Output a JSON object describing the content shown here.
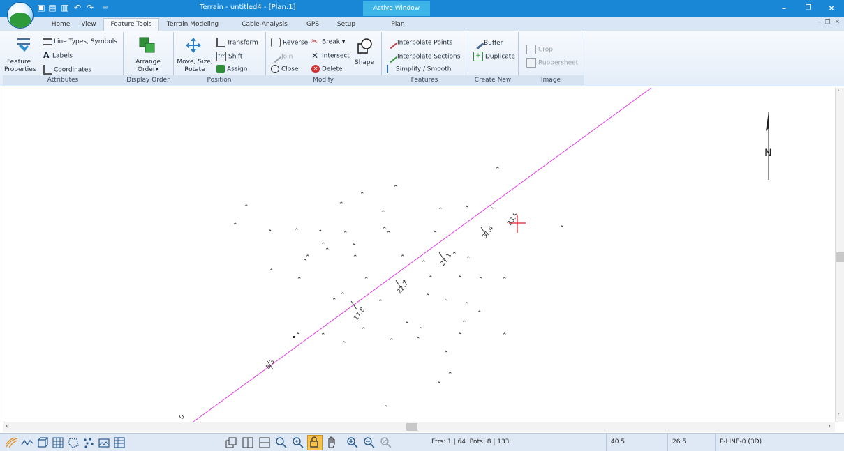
{
  "window": {
    "title": "Terrain - untitled4 - [Plan:1]",
    "active_window_label": "Active Window",
    "controls": [
      "minimize-icon",
      "restore-icon",
      "close-icon"
    ]
  },
  "tabs": [
    "Home",
    "View",
    "Feature Tools",
    "Terrain Modeling",
    "Cable-Analysis",
    "GPS",
    "Setup",
    "Plan"
  ],
  "active_tab": "Feature Tools",
  "ribbon": {
    "attributes": {
      "label": "Attributes",
      "feature_properties": "Feature Properties",
      "line_types": "Line Types, Symbols",
      "labels": "Labels",
      "coordinates": "Coordinates"
    },
    "display_order": {
      "label": "Display Order",
      "arrange_order": "Arrange Order"
    },
    "position": {
      "label": "Position",
      "move_size_rotate": "Move, Size, Rotate",
      "transform": "Transform",
      "shift": "Shift",
      "assign": "Assign"
    },
    "modify": {
      "label": "Modify",
      "reverse": "Reverse",
      "break": "Break",
      "join": "Join",
      "intersect": "Intersect",
      "close": "Close",
      "delete": "Delete",
      "shape": "Shape"
    },
    "features": {
      "label": "Features",
      "interpolate_points": "Interpolate Points",
      "interpolate_sections": "Interpolate Sections",
      "simplify_smooth": "Simplify / Smooth"
    },
    "create_new": {
      "label": "Create New",
      "buffer": "Buffer",
      "duplicate": "Duplicate"
    },
    "image": {
      "label": "Image",
      "crop": "Crop",
      "rubbersheet": "Rubbersheet"
    }
  },
  "plan": {
    "north_label": "N",
    "station_labels": [
      "0",
      "8.3",
      "17.8",
      "22.7",
      "27.1",
      "31.4",
      "33.5"
    ],
    "line_color": "#e040e0",
    "marker_color": "#e02020"
  },
  "statusbar": {
    "features": "Ftrs: 1 | 64",
    "points": "Pnts: 8 | 133",
    "x": "40.5",
    "y": "26.5",
    "layer": "P-LINE-0 (3D)"
  }
}
